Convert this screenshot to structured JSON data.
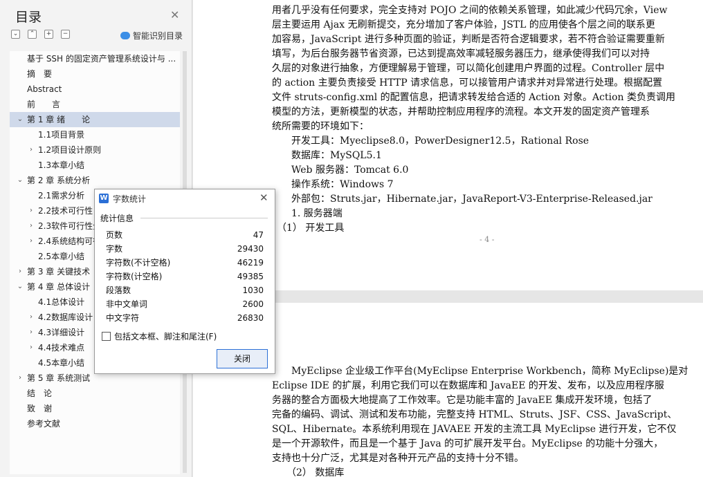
{
  "outline": {
    "title": "目录",
    "smart_label": "智能识别目录",
    "items": [
      {
        "label": "基于 SSH 的固定资产管理系统设计与 ...",
        "level": 1,
        "expander": ""
      },
      {
        "label": "摘　要",
        "level": 1,
        "expander": ""
      },
      {
        "label": "Abstract",
        "level": 1,
        "expander": ""
      },
      {
        "label": "前　　言",
        "level": 1,
        "expander": ""
      },
      {
        "label": "第 1 章  绪　　论",
        "level": 1,
        "expander": "open",
        "selected": true
      },
      {
        "label": "1.1项目背景",
        "level": 2,
        "expander": ""
      },
      {
        "label": "1.2项目设计原则",
        "level": 2,
        "expander": "closed"
      },
      {
        "label": "1.3本章小结",
        "level": 2,
        "expander": ""
      },
      {
        "label": "第 2 章  系统分析",
        "level": 1,
        "expander": "open"
      },
      {
        "label": "2.1需求分析",
        "level": 2,
        "expander": ""
      },
      {
        "label": "2.2技术可行性",
        "level": 2,
        "expander": "closed"
      },
      {
        "label": "2.3软件可行性分析",
        "level": 2,
        "expander": "closed"
      },
      {
        "label": "2.4系统结构可行性",
        "level": 2,
        "expander": "closed"
      },
      {
        "label": "2.5本章小结",
        "level": 2,
        "expander": ""
      },
      {
        "label": "第 3 章  关键技术",
        "level": 1,
        "expander": "closed"
      },
      {
        "label": "第 4 章  总体设计",
        "level": 1,
        "expander": "open"
      },
      {
        "label": "4.1总体设计",
        "level": 2,
        "expander": ""
      },
      {
        "label": "4.2数据库设计",
        "level": 2,
        "expander": "closed"
      },
      {
        "label": "4.3详细设计",
        "level": 2,
        "expander": "closed"
      },
      {
        "label": "4.4技术难点",
        "level": 2,
        "expander": "closed"
      },
      {
        "label": "4.5本章小结",
        "level": 2,
        "expander": ""
      },
      {
        "label": "第 5 章  系统测试",
        "level": 1,
        "expander": "closed"
      },
      {
        "label": "结　论",
        "level": 1,
        "expander": ""
      },
      {
        "label": "致　谢",
        "level": 1,
        "expander": ""
      },
      {
        "label": "参考文献",
        "level": 1,
        "expander": ""
      }
    ]
  },
  "page1": {
    "lines": [
      "用者几乎没有任何要求，完全支持对 POJO 之间的依赖关系管理，如此减少代码冗余，View",
      "层主要运用 Ajax 无刷新提交，充分增加了客户体验，JSTL 的应用使各个层之间的联系更",
      "加容易，JavaScript 进行多种页面的验证，判断是否符合逻辑要求，若不符合验证需要重新",
      "填写，为后台服务器节省资源，已达到提高效率减轻服务器压力，继承使得我们可以对持",
      "久层的对象进行抽象，方便理解易于管理，可以简化创建用户界面的过程。Controller 层中",
      "的 action 主要负责接受 HTTP 请求信息，可以接管用户请求并对异常进行处理。根据配置",
      "文件 struts-config.xml 的配置信息，把请求转发给合适的 Action 对象。Action 类负责调用",
      "模型的方法，更新模型的状态，并帮助控制应用程序的流程。本文开发的固定资产管理系",
      "统所需要的环境如下：",
      "　　开发工具：Myeclipse8.0，PowerDesigner12.5，Rational Rose",
      "　　数据库：MySQL5.1",
      "　　Web 服务器：Tomcat 6.0",
      "　　操作系统：Windows 7",
      "　　外部包：Struts.jar，Hibernate.jar，JavaReport-V3-Enterprise-Released.jar",
      "　　1. 服务器端",
      "　（1） 开发工具"
    ],
    "page_number": "- 4 -"
  },
  "page2": {
    "lines": [
      "　　MyEclipse 企业级工作平台(MyEclipse Enterprise Workbench，简称 MyEclipse)是对",
      "Eclipse IDE 的扩展，利用它我们可以在数据库和 JavaEE 的开发、发布，以及应用程序服",
      "务器的整合方面极大地提高了工作效率。它是功能丰富的 JavaEE 集成开发环境，包括了",
      "完备的编码、调试、测试和发布功能，完整支持 HTML、Struts、JSF、CSS、JavaScript、",
      "SQL、Hibernate。本系统利用现在 JAVAEE 开发的主流工具 MyEclipse 进行开发，它不仅",
      "是一个开源软件，而且是一个基于 Java 的可扩展开发平台。MyEclipse 的功能十分强大，",
      "支持也十分广泛，尤其是对各种开元产品的支持十分不错。",
      "　　（2） 数据库"
    ]
  },
  "dialog": {
    "title": "字数统计",
    "icon_letter": "W",
    "group_label": "统计信息",
    "stats": [
      {
        "label": "页数",
        "value": "47"
      },
      {
        "label": "字数",
        "value": "29430"
      },
      {
        "label": "字符数(不计空格)",
        "value": "46219"
      },
      {
        "label": "字符数(计空格)",
        "value": "49385"
      },
      {
        "label": "段落数",
        "value": "1030"
      },
      {
        "label": "非中文单词",
        "value": "2600"
      },
      {
        "label": "中文字符",
        "value": "26830"
      }
    ],
    "checkbox_label": "包括文本框、脚注和尾注(F)",
    "checkbox_checked": false,
    "close_label": "关闭"
  }
}
